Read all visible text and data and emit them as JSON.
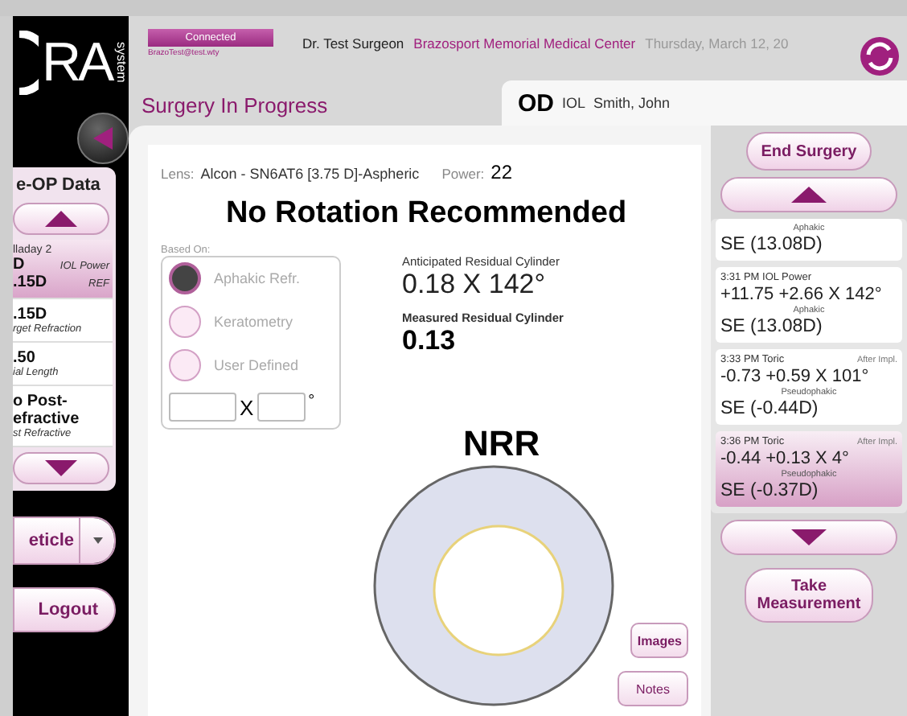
{
  "status": {
    "label": "Connected",
    "account": "BrazoTest@test.wty"
  },
  "header": {
    "surgeon": "Dr. Test Surgeon",
    "hospital": "Brazosport Memorial Medical Center",
    "date": "Thursday, March 12, 20"
  },
  "logo": {
    "text": "RA",
    "subtext": "system"
  },
  "title": "Surgery In Progress",
  "patient": {
    "eye": "OD",
    "procedure": "IOL",
    "name": "Smith, John"
  },
  "sidebar": {
    "heading": "e-OP Data",
    "items": [
      {
        "selected": true,
        "lines": [
          {
            "kind": "small",
            "text": "lladay 2"
          },
          {
            "kind": "pair",
            "text": "D",
            "note": "IOL Power"
          },
          {
            "kind": "pair",
            "text": ".15D",
            "note": "REF"
          }
        ]
      },
      {
        "selected": false,
        "lines": [
          {
            "kind": "big",
            "text": ".15D"
          },
          {
            "kind": "note",
            "text": "rget Refraction"
          }
        ]
      },
      {
        "selected": false,
        "lines": [
          {
            "kind": "big",
            "text": ".50"
          },
          {
            "kind": "note",
            "text": "ial Length"
          }
        ]
      },
      {
        "selected": false,
        "lines": [
          {
            "kind": "big",
            "text": "o Post-"
          },
          {
            "kind": "big",
            "text": "efractive"
          },
          {
            "kind": "note",
            "text": "st Refractive"
          }
        ]
      }
    ],
    "reticle": "eticle",
    "logout": "Logout"
  },
  "lens": {
    "label": "Lens:",
    "value": "Alcon - SN6AT6 [3.75 D]-Aspheric",
    "power_label": "Power:",
    "power": "22"
  },
  "recommendation": "No Rotation Recommended",
  "based_on": {
    "label": "Based On:",
    "options": [
      {
        "label": "Aphakic Refr.",
        "selected": true
      },
      {
        "label": "Keratometry",
        "selected": false
      },
      {
        "label": "User Defined",
        "selected": false
      }
    ],
    "separator": "X",
    "degree": "°"
  },
  "anticipated": {
    "label": "Anticipated Residual Cylinder",
    "value": "0.18 X 142°"
  },
  "measured": {
    "label": "Measured Residual Cylinder",
    "value": "0.13"
  },
  "diagram": {
    "label": "NRR"
  },
  "images_button": "Images",
  "notes_button": "Notes",
  "end_button": "End Surgery",
  "take_button": "Take Measurement",
  "measurements": [
    {
      "selected": false,
      "state": "Aphakic",
      "se": "SE (13.08D)"
    },
    {
      "selected": false,
      "time": "3:31 PM IOL Power",
      "value": "+11.75 +2.66 X 142°",
      "state": "Aphakic",
      "se": "SE (13.08D)"
    },
    {
      "selected": false,
      "time": "3:33 PM Toric",
      "tag": "After Impl.",
      "value": "-0.73 +0.59 X 101°",
      "state": "Pseudophakic",
      "se": "SE (-0.44D)"
    },
    {
      "selected": true,
      "time": "3:36 PM Toric",
      "tag": "After Impl.",
      "value": "-0.44 +0.13 X 4°",
      "state": "Pseudophakic",
      "se": "SE (-0.37D)"
    }
  ]
}
